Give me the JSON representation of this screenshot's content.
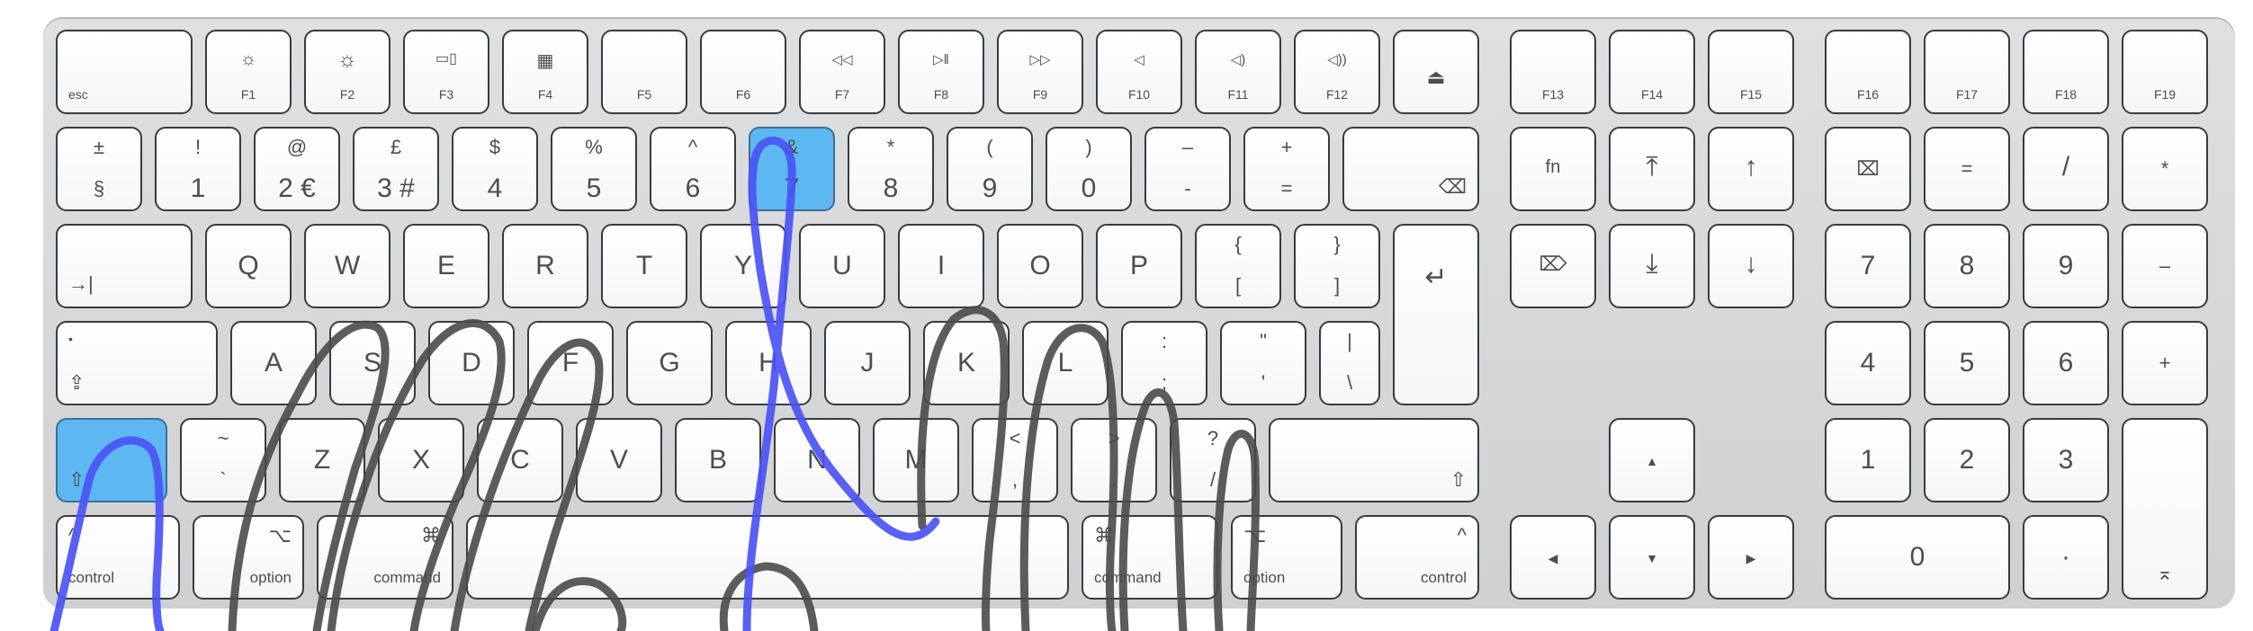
{
  "keyboard": {
    "fn_row": {
      "esc": "esc",
      "f1": "F1",
      "f2": "F2",
      "f3": "F3",
      "f4": "F4",
      "f5": "F5",
      "f6": "F6",
      "f7": "F7",
      "f8": "F8",
      "f9": "F9",
      "f10": "F10",
      "f11": "F11",
      "f12": "F12",
      "f13": "F13",
      "f14": "F14",
      "f15": "F15",
      "f16": "F16",
      "f17": "F17",
      "f18": "F18",
      "f19": "F19",
      "icons": {
        "f1": "☼",
        "f2": "☼",
        "f3": "▭▯",
        "f4": "▦",
        "f7": "◁◁",
        "f8": "▷‖",
        "f9": "▷▷",
        "f10": "◁",
        "f11": "◁)",
        "f12": "◁))",
        "eject": "⏏"
      }
    },
    "number_row": [
      {
        "top": "±",
        "bottom": "§"
      },
      {
        "top": "!",
        "bottom": "1"
      },
      {
        "top": "@",
        "bottom": "2 €"
      },
      {
        "top": "£",
        "bottom": "3 #"
      },
      {
        "top": "$",
        "bottom": "4"
      },
      {
        "top": "%",
        "bottom": "5"
      },
      {
        "top": "^",
        "bottom": "6"
      },
      {
        "top": "&",
        "bottom": "7"
      },
      {
        "top": "*",
        "bottom": "8"
      },
      {
        "top": "(",
        "bottom": "9"
      },
      {
        "top": ")",
        "bottom": "0"
      },
      {
        "top": "–",
        "bottom": "-"
      },
      {
        "top": "+",
        "bottom": "="
      }
    ],
    "delete_icon": "⌫",
    "tab_icon": "→|",
    "qwerty_row": [
      "Q",
      "W",
      "E",
      "R",
      "T",
      "Y",
      "U",
      "I",
      "O",
      "P"
    ],
    "bracket_keys": [
      {
        "top": "{",
        "bottom": "["
      },
      {
        "top": "}",
        "bottom": "]"
      }
    ],
    "return_icon": "↵",
    "caps_dot": "•",
    "caps_icon": "⇪",
    "home_row": [
      "A",
      "S",
      "D",
      "F",
      "G",
      "H",
      "J",
      "K",
      "L"
    ],
    "home_punct": [
      {
        "top": ":",
        "bottom": ";"
      },
      {
        "top": "\"",
        "bottom": "'"
      },
      {
        "top": "|",
        "bottom": "\\"
      }
    ],
    "shift_icon": "⇧",
    "grave_key": {
      "top": "~",
      "bottom": "`"
    },
    "bottom_letters": [
      "Z",
      "X",
      "C",
      "V",
      "B",
      "N",
      "M"
    ],
    "bottom_punct": [
      {
        "top": "<",
        "bottom": ","
      },
      {
        "top": ">",
        "bottom": "."
      },
      {
        "top": "?",
        "bottom": "/"
      }
    ],
    "mod_row": {
      "control": "control",
      "control_icon": "^",
      "option": "option",
      "option_icon": "⌥",
      "command": "command",
      "command_icon": "⌘"
    },
    "nav": {
      "fn": "fn",
      "home_icon": "⤒",
      "pgup_icon": "↑",
      "fwd_delete_icon": "⌦",
      "end_icon": "⤓",
      "pgdn_icon": "↓",
      "arrow_up": "▲",
      "arrow_left": "◀",
      "arrow_down": "▼",
      "arrow_right": "▶"
    },
    "numpad": {
      "clear_icon": "⌧",
      "row1": [
        "=",
        "/",
        "*"
      ],
      "row2": [
        "7",
        "8",
        "9",
        "–"
      ],
      "row3": [
        "4",
        "5",
        "6",
        "+"
      ],
      "row4": [
        "1",
        "2",
        "3"
      ],
      "zero": "0",
      "dot": "·",
      "enter_icon": "⌅"
    }
  },
  "highlighted_keys": [
    "7",
    "left-shift"
  ],
  "colors": {
    "highlight": "#5db8f1",
    "blue_stroke": "#4a52f5",
    "gray_stroke": "#4a4a4a"
  }
}
